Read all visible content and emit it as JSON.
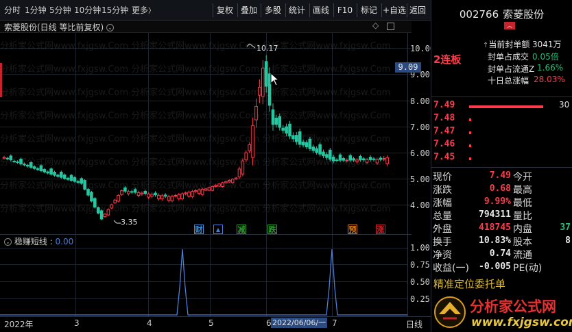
{
  "toolbar": {
    "timeframes": [
      "分时",
      "1分钟",
      "5分钟",
      "10分钟",
      "15分钟",
      "更多"
    ],
    "more_arrow": "〉",
    "buttons": [
      "复权",
      "叠加",
      "多股",
      "统计",
      "画线",
      "F10",
      "标记",
      "+自选",
      "返回"
    ]
  },
  "chart": {
    "title": "索菱股份(日线 等比前复权)",
    "price_labels": [
      "10.00",
      "9.00",
      "8.00",
      "7.00",
      "6.00",
      "5.00",
      "4.00"
    ],
    "current_price_tag": "9.09",
    "high_mark": "10.17",
    "low_mark": "3.35",
    "signals": [
      {
        "text": "财",
        "color": "#3a8fd8"
      },
      {
        "text": "▲",
        "color": "#4a7fd0"
      },
      {
        "text": "减",
        "color": "#27a02a"
      },
      {
        "text": "跌",
        "color": "#27a02a"
      },
      {
        "text": "预",
        "color": "#d07a20"
      },
      {
        "text": "涨",
        "color": "#c8232c"
      }
    ]
  },
  "indicator": {
    "name": "稳赚短线",
    "value": "0.00",
    "levels": [
      "1.00",
      "0.75",
      "0.50",
      "0.25"
    ]
  },
  "date_axis": {
    "labels": [
      "2022年",
      "3",
      "4",
      "5",
      "6",
      "7"
    ],
    "cursor_date": "2022/06/06/一",
    "period": "日线"
  },
  "watermark": {
    "text": "分析家公式网www.fxjgsw.Com",
    "logo_text": "分析家公式网",
    "logo_url": "www.fxjgsw.com"
  },
  "quote": {
    "code": "002766",
    "name": "索菱股份",
    "seal_amount_label": "当前封单额",
    "seal_amount": "3041万",
    "seal_trade_label": "封单占成交",
    "seal_trade": "0.05倍",
    "seal_float_label": "封单占流通Z",
    "seal_float": "1.66%",
    "ten_day_label": "十日总涨幅",
    "ten_day": "28.03%",
    "limit_up": "2连板",
    "bid_levels": [
      {
        "price": "7.49",
        "vol": "30",
        "bar": 0.9
      },
      {
        "price": "7.48",
        "vol": "",
        "bar": 0.02
      },
      {
        "price": "7.47",
        "vol": "",
        "bar": 0.02
      },
      {
        "price": "7.46",
        "vol": "",
        "bar": 0.02
      },
      {
        "price": "7.45",
        "vol": "",
        "bar": 0.02
      }
    ],
    "rows": [
      {
        "l1": "现价",
        "v1": "7.49",
        "l2": "今开",
        "v2": "",
        "c1": "red"
      },
      {
        "l1": "涨跌",
        "v1": "0.68",
        "l2": "最高",
        "v2": "",
        "c1": "red"
      },
      {
        "l1": "涨幅",
        "v1": "9.99%",
        "l2": "最低",
        "v2": "",
        "c1": "red"
      },
      {
        "l1": "总量",
        "v1": "794311",
        "l2": "量比",
        "v2": "",
        "c1": "white"
      },
      {
        "l1": "外盘",
        "v1": "418745",
        "l2": "内盘",
        "v2": "37",
        "c1": "red"
      },
      {
        "l1": "换手",
        "v1": "10.83%",
        "l2": "股本",
        "v2": "8",
        "c1": "white"
      },
      {
        "l1": "净资",
        "v1": "0.74",
        "l2": "流通",
        "v2": "",
        "c1": "white"
      },
      {
        "l1": "收益(一)",
        "v1": "-0.005",
        "l2": "PE(动)",
        "v2": "",
        "c1": "white"
      }
    ],
    "footer_text": "精准定位委托单"
  },
  "colors": {
    "up": "#ff3b4a",
    "down": "#27c6a0",
    "indicator": "#4a7ed8",
    "price_tag_bg": "#2a4a80"
  }
}
